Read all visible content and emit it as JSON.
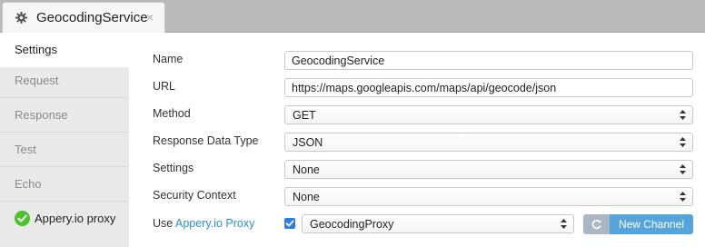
{
  "tab": {
    "title": "GeocodingService",
    "close_glyph": "×",
    "icon": "gear-icon"
  },
  "nav": {
    "items": [
      {
        "label": "Settings",
        "active": true
      },
      {
        "label": "Request"
      },
      {
        "label": "Response"
      },
      {
        "label": "Test"
      },
      {
        "label": "Echo"
      },
      {
        "label": "Appery.io proxy",
        "status_icon": "check-circle-icon"
      }
    ]
  },
  "form": {
    "name": {
      "label": "Name",
      "value": "GeocodingService"
    },
    "url": {
      "label": "URL",
      "value": "https://maps.googleapis.com/maps/api/geocode/json"
    },
    "method": {
      "label": "Method",
      "value": "GET"
    },
    "response_data_type": {
      "label": "Response Data Type",
      "value": "JSON"
    },
    "settings": {
      "label": "Settings",
      "value": "None"
    },
    "security_context": {
      "label": "Security Context",
      "value": "None"
    },
    "proxy": {
      "label_prefix": "Use ",
      "label_link": "Appery.io Proxy",
      "checked": true,
      "value": "GeocodingProxy",
      "new_channel_label": "New Channel"
    }
  },
  "colors": {
    "accent": "#55a5dc",
    "link": "#2a8fce",
    "success": "#4cc02e",
    "checkbox": "#2d7be5"
  }
}
